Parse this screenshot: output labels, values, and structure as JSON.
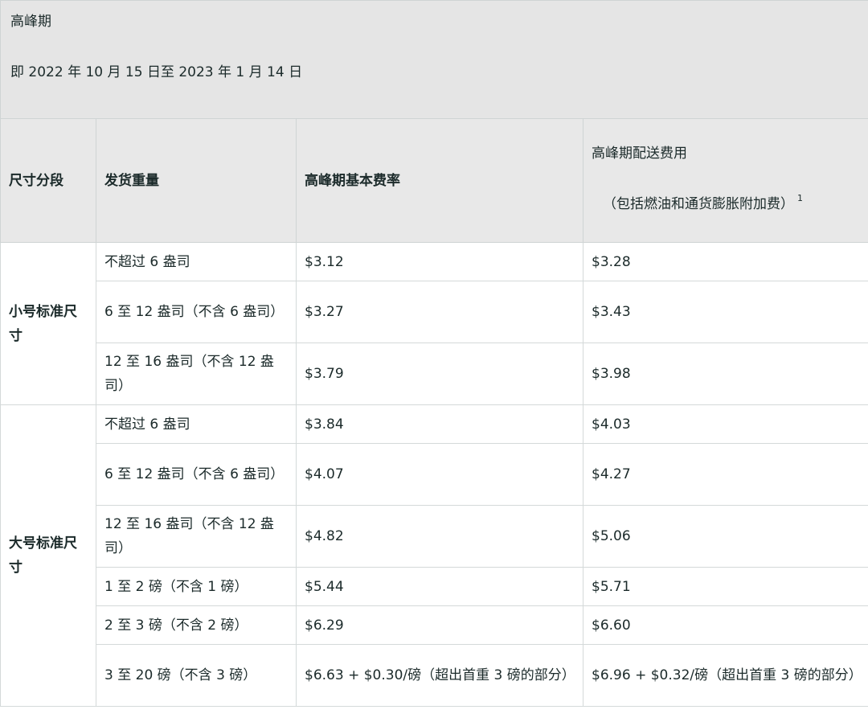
{
  "period": {
    "title": "高峰期",
    "range": "即 2022 年 10 月 15 日至 2023 年 1 月 14 日"
  },
  "headers": {
    "size_tier": "尺寸分段",
    "weight": "发货重量",
    "base_rate": "高峰期基本费率",
    "fee_line1": "高峰期配送费用",
    "fee_line2": "（包括燃油和通货膨胀附加费）",
    "fee_note": "1"
  },
  "groups": [
    {
      "name": "小号标准尺寸",
      "rows": [
        {
          "weight": "不超过 6 盎司",
          "base": "$3.12",
          "fee": "$3.28"
        },
        {
          "weight": "6 至 12 盎司（不含 6 盎司）",
          "base": "$3.27",
          "fee": "$3.43"
        },
        {
          "weight": "12 至 16 盎司（不含 12 盎司）",
          "base": "$3.79",
          "fee": "$3.98"
        }
      ]
    },
    {
      "name": "大号标准尺寸",
      "rows": [
        {
          "weight": "不超过 6 盎司",
          "base": "$3.84",
          "fee": "$4.03"
        },
        {
          "weight": "6 至 12 盎司（不含 6 盎司）",
          "base": "$4.07",
          "fee": "$4.27"
        },
        {
          "weight": "12 至 16 盎司（不含 12 盎司）",
          "base": "$4.82",
          "fee": "$5.06"
        },
        {
          "weight": "1 至 2 磅（不含 1 磅）",
          "base": "$5.44",
          "fee": "$5.71"
        },
        {
          "weight": "2 至 3 磅（不含 2 磅）",
          "base": "$6.29",
          "fee": "$6.60"
        },
        {
          "weight": "3 至 20 磅（不含 3 磅）",
          "base": "$6.63 + $0.30/磅（超出首重 3 磅的部分）",
          "fee": "$6.96 + $0.32/磅（超出首重 3 磅的部分）"
        }
      ]
    }
  ]
}
